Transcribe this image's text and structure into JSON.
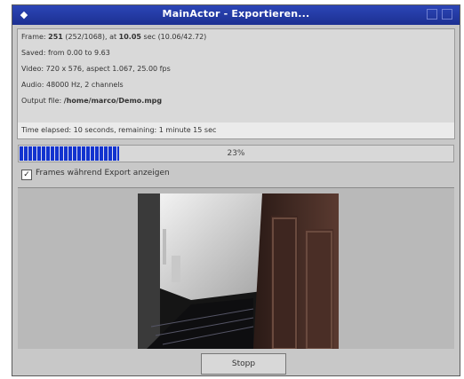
{
  "window": {
    "title": "MainActor - Exportieren..."
  },
  "info": {
    "frame_label": "Frame:",
    "frame_value": "251",
    "frame_detail": "(252/1068), at",
    "frame_time": "10.05",
    "frame_suffix": "sec (10.06/42.72)",
    "saved": "Saved: from 0.00 to 9.63",
    "video": "Video: 720 x 576, aspect 1.067, 25.00 fps",
    "audio": "Audio: 48000 Hz, 2 channels",
    "output_label": "Output file:",
    "output_value": "/home/marco/Demo.mpg",
    "time_elapsed": "Time elapsed: 10 seconds, remaining: 1 minute 15 sec"
  },
  "progress": {
    "value": 0.23,
    "label": "23%"
  },
  "checkbox": {
    "checked": true,
    "label": "Frames während Export anzeigen"
  },
  "button": {
    "stop_label": "Stopp"
  },
  "colors": {
    "titlebar": "#1f3399",
    "progress": "#1233cf"
  }
}
